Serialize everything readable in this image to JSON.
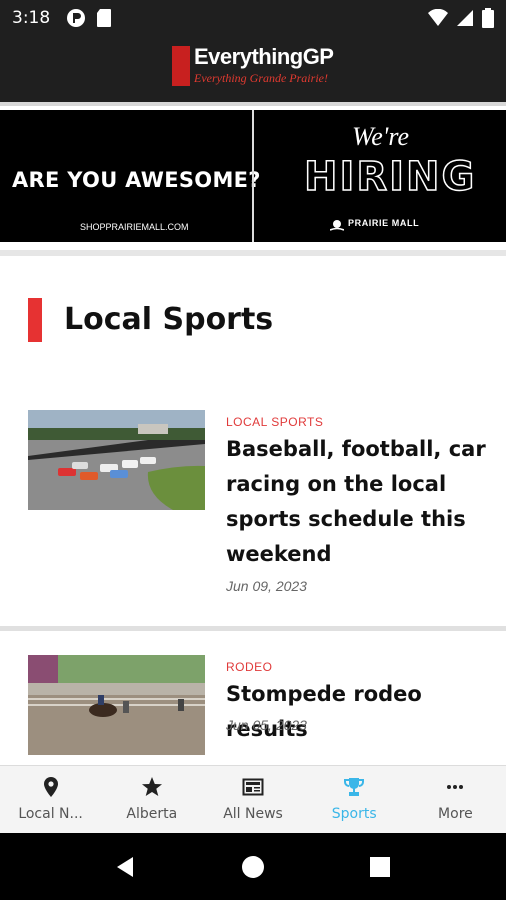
{
  "status_bar": {
    "time": "3:18",
    "left_icons": [
      "app-notification-icon",
      "sd-card-icon"
    ],
    "right_icons": [
      "wifi-icon",
      "cell-signal-icon",
      "battery-icon"
    ]
  },
  "header": {
    "logo_title": "EverythingGP",
    "logo_tagline": "Everything Grande Prairie!"
  },
  "banner_ad": {
    "left_headline": "ARE YOU AWESOME?",
    "left_url": "SHOPPRAIRIEMALL.COM",
    "right_were": "We're",
    "right_hiring": "HIRING",
    "right_brand": "PRAIRIE MALL"
  },
  "section": {
    "title": "Local Sports",
    "accent_color": "#e63232"
  },
  "articles": [
    {
      "category": "LOCAL SPORTS",
      "title": "Baseball, football, car racing on the local sports schedule this weekend",
      "date": "Jun 09, 2023",
      "image": "car-racing-photo"
    },
    {
      "category": "RODEO",
      "title": "Stompede rodeo results",
      "date": "Jun 05, 2023",
      "image": "rodeo-photo"
    }
  ],
  "bottom_nav": {
    "active_color": "#3ab6e8",
    "items": [
      {
        "label": "Local N...",
        "icon": "location-pin-icon",
        "active": false
      },
      {
        "label": "Alberta",
        "icon": "star-icon",
        "active": false
      },
      {
        "label": "All News",
        "icon": "newspaper-icon",
        "active": false
      },
      {
        "label": "Sports",
        "icon": "trophy-icon",
        "active": true
      },
      {
        "label": "More",
        "icon": "more-dots-icon",
        "active": false
      }
    ]
  },
  "system_nav": {
    "buttons": [
      "back-icon",
      "home-icon",
      "recents-icon"
    ]
  }
}
